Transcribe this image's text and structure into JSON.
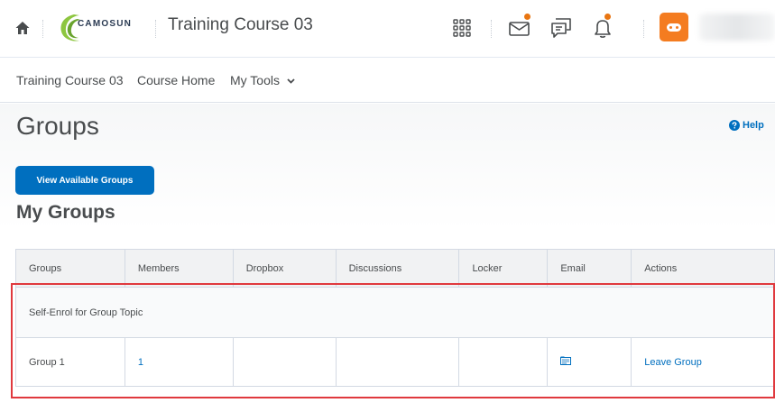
{
  "navbar": {
    "logo_text": "CAMOSUN",
    "course_title": "Training Course 03"
  },
  "subnav": {
    "items": [
      {
        "label": "Training Course 03"
      },
      {
        "label": "Course Home"
      },
      {
        "label": "My Tools"
      }
    ]
  },
  "page": {
    "title": "Groups",
    "help_label": "Help",
    "view_groups_button": "View Available Groups",
    "section_title": "My Groups"
  },
  "table": {
    "headers": [
      "Groups",
      "Members",
      "Dropbox",
      "Discussions",
      "Locker",
      "Email",
      "Actions"
    ],
    "category": "Self-Enrol for Group Topic",
    "row": {
      "group": "Group 1",
      "members": "1",
      "action": "Leave Group"
    }
  },
  "colors": {
    "primary": "#006fbf",
    "notification": "#e87511",
    "highlight": "#e0393e",
    "avatar": "#f47c20",
    "logo_green": "#8dc63f"
  },
  "icons": [
    "home-icon",
    "camosun-logo",
    "apps-grid-icon",
    "email-icon",
    "chat-icon",
    "bell-icon",
    "help-icon",
    "chevron-down-icon",
    "compose-email-icon"
  ]
}
